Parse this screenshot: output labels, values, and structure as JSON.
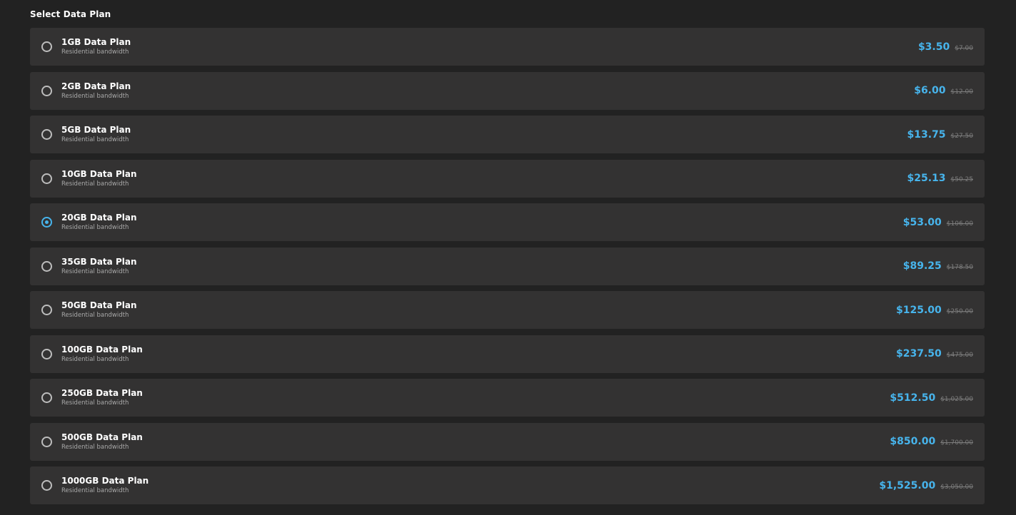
{
  "title": "Select Data Plan",
  "selected_index": 4,
  "colors": {
    "background": "#222222",
    "card": "#333232",
    "accent": "#47b4ec",
    "muted": "#7d7d7d"
  },
  "plans": [
    {
      "name": "1GB Data Plan",
      "subtitle": "Residential bandwidth",
      "price": "$3.50",
      "old_price": "$7.00"
    },
    {
      "name": "2GB Data Plan",
      "subtitle": "Residential bandwidth",
      "price": "$6.00",
      "old_price": "$12.00"
    },
    {
      "name": "5GB Data Plan",
      "subtitle": "Residential bandwidth",
      "price": "$13.75",
      "old_price": "$27.50"
    },
    {
      "name": "10GB Data Plan",
      "subtitle": "Residential bandwidth",
      "price": "$25.13",
      "old_price": "$50.25"
    },
    {
      "name": "20GB Data Plan",
      "subtitle": "Residential bandwidth",
      "price": "$53.00",
      "old_price": "$106.00"
    },
    {
      "name": "35GB Data Plan",
      "subtitle": "Residential bandwidth",
      "price": "$89.25",
      "old_price": "$178.50"
    },
    {
      "name": "50GB Data Plan",
      "subtitle": "Residential bandwidth",
      "price": "$125.00",
      "old_price": "$250.00"
    },
    {
      "name": "100GB Data Plan",
      "subtitle": "Residential bandwidth",
      "price": "$237.50",
      "old_price": "$475.00"
    },
    {
      "name": "250GB Data Plan",
      "subtitle": "Residential bandwidth",
      "price": "$512.50",
      "old_price": "$1,025.00"
    },
    {
      "name": "500GB Data Plan",
      "subtitle": "Residential bandwidth",
      "price": "$850.00",
      "old_price": "$1,700.00"
    },
    {
      "name": "1000GB Data Plan",
      "subtitle": "Residential bandwidth",
      "price": "$1,525.00",
      "old_price": "$3,050.00"
    }
  ]
}
